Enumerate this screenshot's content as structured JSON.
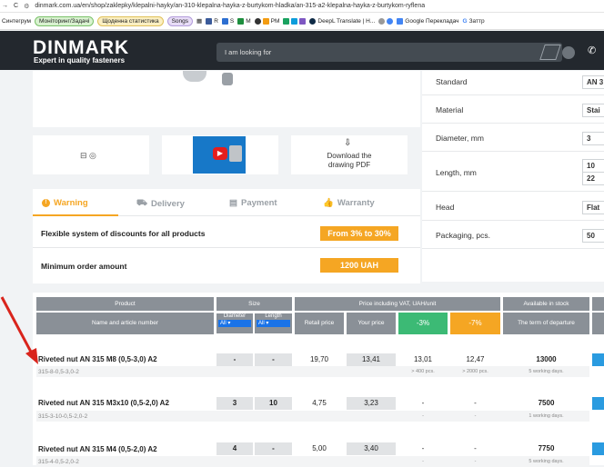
{
  "browser": {
    "url": "dinmark.com.ua/en/shop/zaklepky/klepalni-hayky/an-310-klepalna-hayka-z-burtykom-hladka/an-315-a2-klepalna-hayka-z-burtykom-ryflena",
    "bookmarks": [
      "Синтегрум",
      "Моніторинг/Задачі",
      "Щоденна статистика",
      "Songs",
      "R",
      "S",
      "M",
      "PM",
      "DeepL Translate | H...",
      "Google Перекладач",
      "Заттр"
    ]
  },
  "header": {
    "logo": "DINMARK",
    "tagline": "Expert in quality fasteners",
    "search_placeholder": "I am looking for"
  },
  "media": {
    "download_label_line1": "Download the",
    "download_label_line2": "drawing PDF"
  },
  "tabs": [
    "Warning",
    "Delivery",
    "Payment",
    "Warranty"
  ],
  "promos": [
    {
      "text": "Flexible system of discounts for all products",
      "badge": "From 3% to 30%"
    },
    {
      "text": "Minimum order amount",
      "badge": "1200 UAH"
    }
  ],
  "attributes": [
    {
      "key": "Standard",
      "value": "AN 3"
    },
    {
      "key": "Material",
      "value": "Stai"
    },
    {
      "key": "Diameter, mm",
      "value": "3"
    },
    {
      "key": "Length, mm",
      "value": "10",
      "value2": "22"
    },
    {
      "key": "Head",
      "value": "Flat"
    },
    {
      "key": "Packaging, pcs.",
      "value": "50"
    }
  ],
  "table": {
    "col_product": "Product",
    "col_size": "Size",
    "col_price": "Price including VAT, UAH/unit",
    "col_stock": "Available in stock",
    "sub_name": "Name and article number",
    "sub_diameter": "Diameter",
    "sub_length": "Length",
    "filter_all": "All",
    "sub_retail": "Retail price",
    "sub_your": "Your price",
    "sub_3": "-3%",
    "sub_7": "-7%",
    "sub_term": "The term of departure",
    "rows": [
      {
        "name": "Riveted nut AN 315 M8 (0,5-3,0) A2",
        "article": "315-8-0,5-3,0-2",
        "diameter": "-",
        "length": "-",
        "retail": "19,70",
        "your": "13,41",
        "p3": "13,01",
        "p7": "12,47",
        "stock": "13000",
        "n3": "> 400 pcs.",
        "n7": "> 2000 pcs.",
        "term": "5 working days."
      },
      {
        "name": "Riveted nut AN 315 M3x10 (0,5-2,0) A2",
        "article": "315-3-10-0,5-2,0-2",
        "diameter": "3",
        "length": "10",
        "retail": "4,75",
        "your": "3,23",
        "p3": "-",
        "p7": "-",
        "stock": "7500",
        "n3": "-",
        "n7": "-",
        "term": "1 working days."
      },
      {
        "name": "Riveted nut AN 315 M4 (0,5-2,0) A2",
        "article": "315-4-0,5-2,0-2",
        "diameter": "4",
        "length": "-",
        "retail": "5,00",
        "your": "3,40",
        "p3": "-",
        "p7": "-",
        "stock": "7750",
        "n3": "-",
        "n7": "-",
        "term": "5 working days."
      }
    ]
  },
  "colors": {
    "header": "#23282e",
    "accent_orange": "#f5a623",
    "green": "#3cba75",
    "blue": "#2a9be0",
    "annotation_arrow": "#d9241c"
  }
}
